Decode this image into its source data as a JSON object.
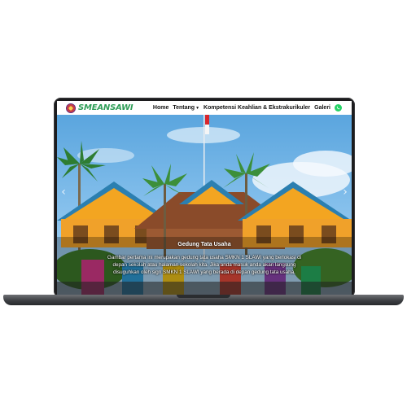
{
  "brand": {
    "name": "SMEANSAWI"
  },
  "nav": {
    "items": [
      {
        "label": "Home"
      },
      {
        "label": "Tentang"
      },
      {
        "label": "Kompetensi Keahlian & Ekstrakurikuler"
      },
      {
        "label": "Galeri"
      }
    ]
  },
  "slide": {
    "title": "Gedung Tata Usaha",
    "description": "Gambar pertama ini merupakan gedung tata usaha SMKN 1 SLAWI yang berlokasi di depan sekolah atau halaman sekolah kita. Jika anda masuk anda akan langsung disuguhkan oleh sign SMKN 1 SLAWI yang berada di depan gedung tata usaha."
  },
  "colors": {
    "brand": "#2f9e58",
    "whatsapp": "#25d366"
  },
  "icons": {
    "whatsapp": "whatsapp-icon",
    "logo": "school-logo-icon",
    "dropdown": "chevron-down-icon"
  }
}
